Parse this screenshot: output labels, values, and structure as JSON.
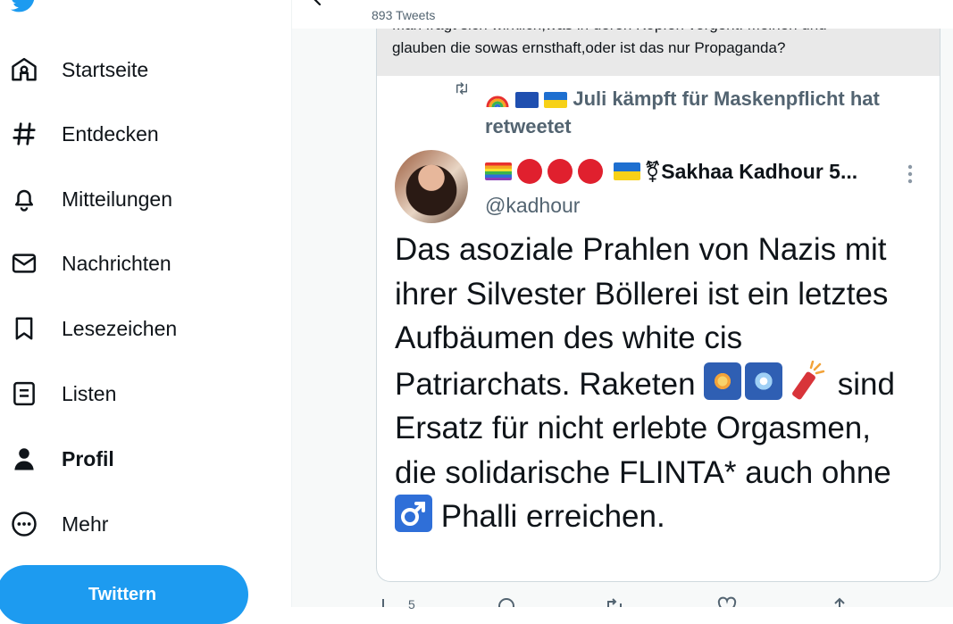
{
  "sidebar": {
    "logo_icon": "twitter-bird-icon",
    "items": [
      {
        "label": "Startseite",
        "icon": "home-icon"
      },
      {
        "label": "Entdecken",
        "icon": "hashtag-icon"
      },
      {
        "label": "Mitteilungen",
        "icon": "bell-icon"
      },
      {
        "label": "Nachrichten",
        "icon": "envelope-icon"
      },
      {
        "label": "Lesezeichen",
        "icon": "bookmark-icon"
      },
      {
        "label": "Listen",
        "icon": "list-icon"
      },
      {
        "label": "Profil",
        "icon": "person-icon",
        "active": true
      },
      {
        "label": "Mehr",
        "icon": "more-circle-icon"
      }
    ],
    "tweet_button": "Twittern"
  },
  "header": {
    "tweet_count": "893 Tweets"
  },
  "quoted_above": {
    "line1": "Man fragt sich wirklich,was in deren Köpfen vorgeht. Meinen und",
    "line2": "glauben die sowas ernsthaft,oder ist das nur Propaganda?"
  },
  "tweet": {
    "retweet_label": "Juli kämpft für Maskenpflicht hat retweetet",
    "author_name": "⚧Sakhaa Kadhour 5...",
    "handle": "@kadhour",
    "body_parts": [
      "Das asoziale Prahlen von Nazis mit ihrer Silvester Böllerei ist ein letztes Aufbäumen des white cis Patriarchats. Raketen",
      "sind Ersatz für nicht erlebte Orgasmen, die solidarische FLINTA* auch ohne",
      "Phalli erreichen."
    ],
    "action_counts": {
      "reply": "5"
    }
  },
  "colors": {
    "accent": "#1d9bf0",
    "secondary_text": "#536471",
    "primary_text": "#0f1419",
    "quote_bg": "#e9e9e9"
  }
}
